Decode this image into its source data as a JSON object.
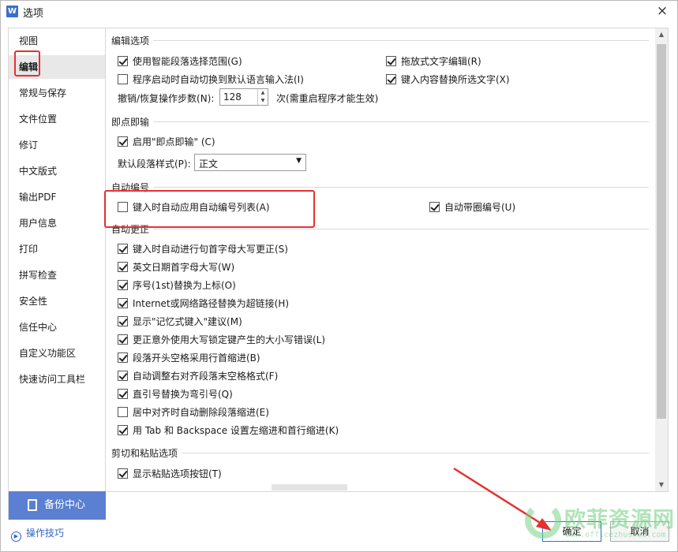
{
  "window": {
    "title": "选项",
    "app_icon": "W",
    "close_glyph": "×"
  },
  "nav": {
    "items": [
      {
        "label": "视图"
      },
      {
        "label": "编辑",
        "active": true
      },
      {
        "label": "常规与保存"
      },
      {
        "label": "文件位置"
      },
      {
        "label": "修订"
      },
      {
        "label": "中文版式"
      },
      {
        "label": "输出PDF"
      },
      {
        "label": "用户信息"
      },
      {
        "label": "打印"
      },
      {
        "label": "拼写检查"
      },
      {
        "label": "安全性"
      },
      {
        "label": "信任中心"
      },
      {
        "label": "自定义功能区"
      },
      {
        "label": "快速访问工具栏"
      }
    ],
    "backup_label": "备份中心",
    "tips_label": "操作技巧",
    "tips_icon_glyph": "▶"
  },
  "edit_options": {
    "title": "编辑选项",
    "smart_select": {
      "label": "使用智能段落选择范围(G)",
      "checked": true
    },
    "drag_drop": {
      "label": "拖放式文字编辑(R)",
      "checked": true
    },
    "auto_ime": {
      "label": "程序启动时自动切换到默认语言输入法(I)",
      "checked": false
    },
    "typing_replaces": {
      "label": "键入内容替换所选文字(X)",
      "checked": true
    },
    "undo_steps_label": "撤销/恢复操作步数(N):",
    "undo_steps_value": "128",
    "undo_steps_suffix": "次(需重启程序才能生效)"
  },
  "click_and_type": {
    "title": "即点即输",
    "enable": {
      "label": "启用\"即点即输\" (C)",
      "checked": true
    },
    "default_style_label": "默认段落样式(P):",
    "default_style_value": "正文"
  },
  "auto_numbering": {
    "title": "自动编号",
    "apply_list": {
      "label": "键入时自动应用自动编号列表(A)",
      "checked": false
    },
    "circle_number": {
      "label": "自动带圈编号(U)",
      "checked": true
    }
  },
  "autocorrect": {
    "title": "自动更正",
    "items": [
      {
        "label": "键入时自动进行句首字母大写更正(S)",
        "checked": true
      },
      {
        "label": "英文日期首字母大写(W)",
        "checked": true
      },
      {
        "label": "序号(1st)替换为上标(O)",
        "checked": true
      },
      {
        "label": "Internet或网络路径替换为超链接(H)",
        "checked": true
      },
      {
        "label": "显示\"记忆式键入\"建议(M)",
        "checked": true
      },
      {
        "label": "更正意外使用大写锁定键产生的大小写错误(L)",
        "checked": true
      },
      {
        "label": "段落开头空格采用行首缩进(B)",
        "checked": true
      },
      {
        "label": "自动调整右对齐段落末空格格式(F)",
        "checked": true
      },
      {
        "label": "直引号替换为弯引号(Q)",
        "checked": true
      },
      {
        "label": "居中对齐时自动删除段落缩进(E)",
        "checked": false
      },
      {
        "label": "用 Tab 和 Backspace 设置左缩进和首行缩进(K)",
        "checked": true
      }
    ]
  },
  "paste_options": {
    "title": "剪切和粘贴选项",
    "show_button": {
      "label": "显示粘贴选项按钮(T)",
      "checked": true
    }
  },
  "buttons": {
    "ok": "确定",
    "cancel": "取消"
  },
  "watermark": {
    "text": "欧菲资源网",
    "sub": "www.officezhushou.com"
  },
  "colors": {
    "accent": "#5b7fd1",
    "highlight_red": "#e53131",
    "ok_border": "#2f6fd8"
  }
}
